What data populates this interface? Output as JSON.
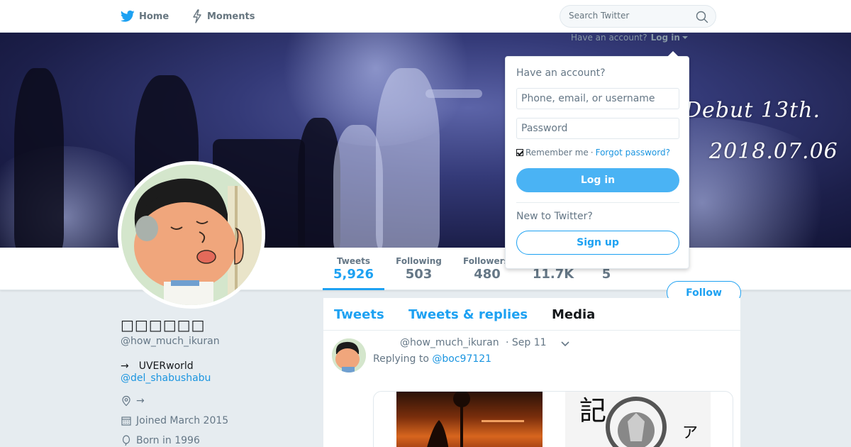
{
  "nav": {
    "home_label": "Home",
    "moments_label": "Moments",
    "home_icon": "twitter-bird-icon",
    "moments_icon": "lightning-icon"
  },
  "search": {
    "placeholder": "Search Twitter",
    "icon": "search-icon"
  },
  "login_prompt": {
    "text": "Have an account?",
    "link": "Log in"
  },
  "banner": {
    "line1": "Debut 13th.",
    "line2": "2018.07.06"
  },
  "profile": {
    "name": "□□□□□□",
    "handle": "@how_much_ikuran",
    "bio": "→　UVERworld",
    "bio_link": "@del_shabushabu",
    "location": "→",
    "joined": "Joined March 2015",
    "born": "Born in 1996"
  },
  "stats": [
    {
      "label": "Tweets",
      "value": "5,926"
    },
    {
      "label": "Following",
      "value": "503"
    },
    {
      "label": "Followers",
      "value": "480"
    },
    {
      "label": "",
      "value": "11.7K"
    },
    {
      "label": "",
      "value": "5"
    }
  ],
  "follow_button": "Follow",
  "timeline": {
    "tabs": [
      "Tweets",
      "Tweets & replies",
      "Media"
    ],
    "active_tab": "Media",
    "tweet": {
      "handle": "@how_much_ikuran",
      "date": "· Sep 11",
      "reply_prefix": "Replying to",
      "reply_to": "@boc97121"
    }
  },
  "login_dropdown": {
    "title": "Have an account?",
    "username_placeholder": "Phone, email, or username",
    "password_placeholder": "Password",
    "remember_label": "Remember me",
    "separator": "·",
    "forgot_label": "Forgot password?",
    "login_button": "Log in",
    "new_label": "New to Twitter?",
    "signup_button": "Sign up"
  },
  "colors": {
    "brand": "#1da1f2",
    "link": "#1b95e0",
    "muted": "#657786",
    "background": "#e6ecf0"
  }
}
